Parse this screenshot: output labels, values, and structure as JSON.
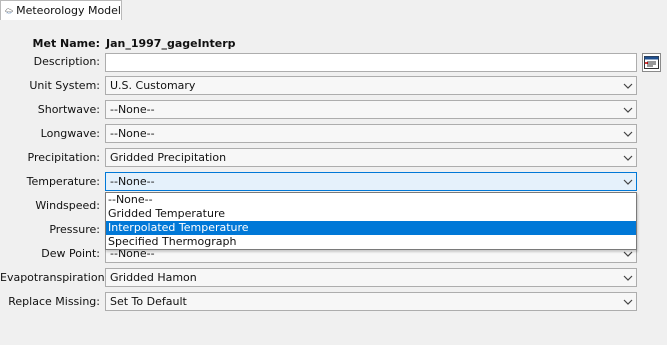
{
  "tab": {
    "label": "Meteorology Model",
    "icon": "meteorology-model-icon"
  },
  "form": {
    "met_name_label": "Met Name:",
    "met_name_value": "Jan_1997_gageInterp",
    "description_label": "Description:",
    "description_value": "",
    "fields": [
      {
        "label": "Unit System:",
        "value": "U.S. Customary"
      },
      {
        "label": "Shortwave:",
        "value": "--None--"
      },
      {
        "label": "Longwave:",
        "value": "--None--"
      },
      {
        "label": "Precipitation:",
        "value": "Gridded Precipitation"
      },
      {
        "label": "Temperature:",
        "value": "--None--"
      },
      {
        "label": "Windspeed:",
        "value": ""
      },
      {
        "label": "Pressure:",
        "value": ""
      },
      {
        "label": "Dew Point:",
        "value": "--None--"
      },
      {
        "label": "Evapotranspiration:",
        "value": "Gridded Hamon"
      },
      {
        "label": "Replace Missing:",
        "value": "Set To Default"
      }
    ]
  },
  "temperature_dropdown": {
    "options": [
      "--None--",
      "Gridded Temperature",
      "Interpolated Temperature",
      "Specified Thermograph"
    ],
    "highlighted": "Interpolated Temperature"
  },
  "colors": {
    "selection": "#0078d7",
    "active_field": "#e5f1fb"
  }
}
